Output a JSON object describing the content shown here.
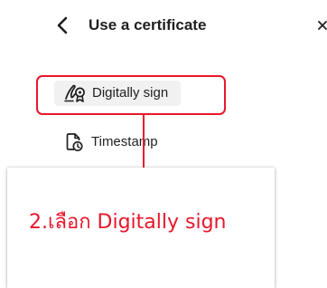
{
  "header": {
    "back_icon": "chevron-left-icon",
    "title": "Use a certificate",
    "close_icon": "close-icon"
  },
  "menu": {
    "items": [
      {
        "label": "Digitally sign",
        "icon": "digital-sign-icon",
        "selected": true
      },
      {
        "label": "Timestamp",
        "icon": "timestamp-icon",
        "selected": false
      }
    ]
  },
  "annotation": {
    "text": "2.เลือก Digitally sign",
    "color": "#e8172b"
  }
}
